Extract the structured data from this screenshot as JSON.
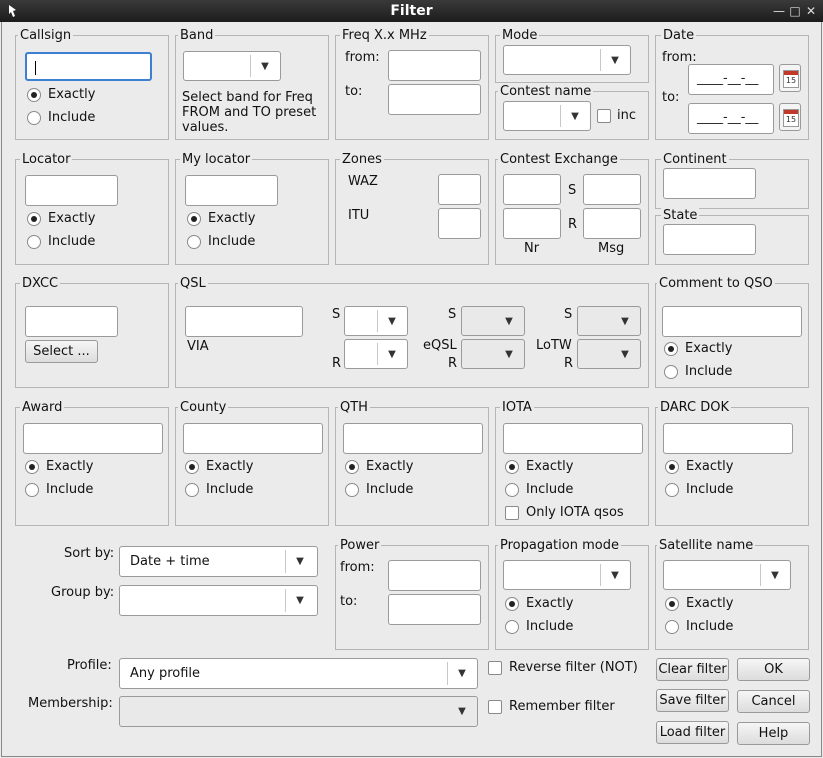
{
  "window": {
    "title": "Filter"
  },
  "callsign": {
    "title": "Callsign",
    "exactly": "Exactly",
    "include": "Include"
  },
  "band": {
    "title": "Band",
    "hint": "Select band for Freq FROM and TO preset values."
  },
  "freq": {
    "title": "Freq  X.x MHz",
    "from": "from:",
    "to": "to:"
  },
  "mode": {
    "title": "Mode"
  },
  "contest": {
    "title": "Contest name",
    "inc": "inc"
  },
  "date": {
    "title": "Date",
    "from": "from:",
    "to": "to:",
    "from_value": "____-__-__",
    "to_value": "____-__-__",
    "cal_num": "15"
  },
  "locator": {
    "title": "Locator",
    "exactly": "Exactly",
    "include": "Include"
  },
  "mylocator": {
    "title": "My locator",
    "exactly": "Exactly",
    "include": "Include"
  },
  "zones": {
    "title": "Zones",
    "waz": "WAZ",
    "itu": "ITU"
  },
  "exchange": {
    "title": "Contest Exchange",
    "s": "S",
    "r": "R",
    "nr": "Nr",
    "msg": "Msg"
  },
  "continent": {
    "title": "Continent"
  },
  "state": {
    "title": "State"
  },
  "dxcc": {
    "title": "DXCC",
    "select": "Select ..."
  },
  "qsl": {
    "title": "QSL",
    "via": "VIA",
    "s1": "S",
    "r1": "R",
    "s2": "S",
    "eqsl": "eQSL",
    "r2": "R",
    "s3": "S",
    "lotw": "LoTW",
    "r3": "R"
  },
  "comment": {
    "title": "Comment to QSO",
    "exactly": "Exactly",
    "include": "Include"
  },
  "award": {
    "title": "Award",
    "exactly": "Exactly",
    "include": "Include"
  },
  "county": {
    "title": "County",
    "exactly": "Exactly",
    "include": "Include"
  },
  "qth": {
    "title": "QTH",
    "exactly": "Exactly",
    "include": "Include"
  },
  "iota": {
    "title": "IOTA",
    "exactly": "Exactly",
    "include": "Include",
    "only": "Only IOTA qsos"
  },
  "darc": {
    "title": "DARC DOK",
    "exactly": "Exactly",
    "include": "Include"
  },
  "sort": {
    "sort_label": "Sort by:",
    "sort_value": "Date + time",
    "group_label": "Group by:"
  },
  "power": {
    "title": "Power",
    "from": "from:",
    "to": "to:"
  },
  "prop": {
    "title": "Propagation mode",
    "exactly": "Exactly",
    "include": "Include"
  },
  "sat": {
    "title": "Satellite name",
    "exactly": "Exactly",
    "include": "Include"
  },
  "profile": {
    "label": "Profile:",
    "value": "Any profile",
    "membership": "Membership:"
  },
  "options": {
    "reverse": "Reverse filter (NOT)",
    "remember": "Remember filter"
  },
  "buttons": {
    "clear": "Clear filter",
    "ok": "OK",
    "save": "Save filter",
    "cancel": "Cancel",
    "load": "Load filter",
    "help": "Help"
  }
}
